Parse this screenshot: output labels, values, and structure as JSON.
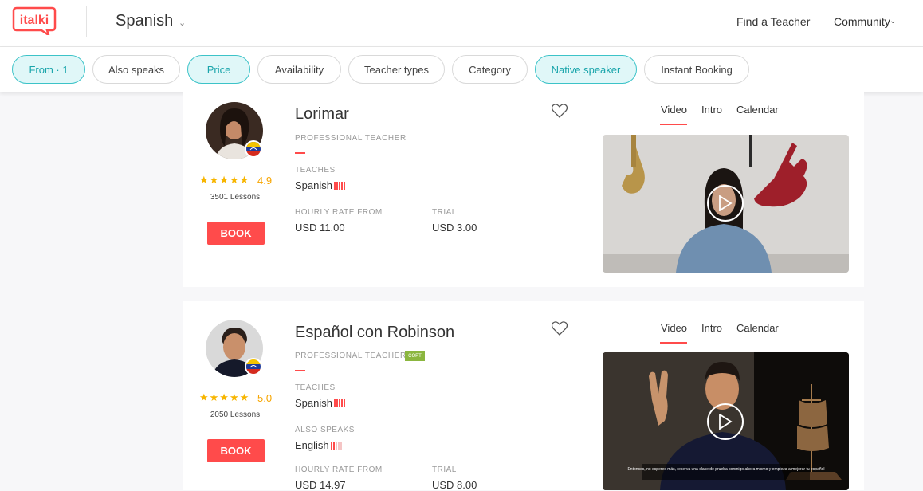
{
  "header": {
    "logo_text": "italki",
    "language": "Spanish",
    "nav": {
      "find_teacher": "Find a Teacher",
      "community": "Community"
    }
  },
  "filters": [
    {
      "label": "From · 1",
      "active": true
    },
    {
      "label": "Also speaks",
      "active": false
    },
    {
      "label": "Price",
      "active": true
    },
    {
      "label": "Availability",
      "active": false
    },
    {
      "label": "Teacher types",
      "active": false
    },
    {
      "label": "Category",
      "active": false
    },
    {
      "label": "Native speaker",
      "active": true
    },
    {
      "label": "Instant Booking",
      "active": false
    }
  ],
  "teachers": [
    {
      "name": "Lorimar",
      "role": "PROFESSIONAL TEACHER",
      "rating": "4.9",
      "stars": 5,
      "lessons": "3501 Lessons",
      "book_label": "BOOK",
      "teaches_label": "TEACHES",
      "teaches": "Spanish",
      "rate_label": "HOURLY RATE FROM",
      "rate": "USD 11.00",
      "trial_label": "TRIAL",
      "trial": "USD 3.00",
      "flag": "venezuela-flag-icon",
      "tabs": [
        "Video",
        "Intro",
        "Calendar"
      ],
      "active_tab": "Video"
    },
    {
      "name": "Español con Robinson",
      "role": "PROFESSIONAL TEACHER",
      "badge": "COPT",
      "rating": "5.0",
      "stars": 5,
      "lessons": "2050 Lessons",
      "book_label": "BOOK",
      "teaches_label": "TEACHES",
      "teaches": "Spanish",
      "also_label": "ALSO SPEAKS",
      "also": "English",
      "rate_label": "HOURLY RATE FROM",
      "rate": "USD 14.97",
      "trial_label": "TRIAL",
      "trial": "USD 8.00",
      "flag": "venezuela-flag-icon",
      "tabs": [
        "Video",
        "Intro",
        "Calendar"
      ],
      "active_tab": "Video",
      "subtitle": "Entonces, no esperes más, reserva una clase de prueba conmigo ahora mismo y empieza a mejorar tu español"
    }
  ],
  "colors": {
    "accent": "#ff4b4b",
    "teal": "#3cc3c8",
    "star": "#f7b500"
  }
}
